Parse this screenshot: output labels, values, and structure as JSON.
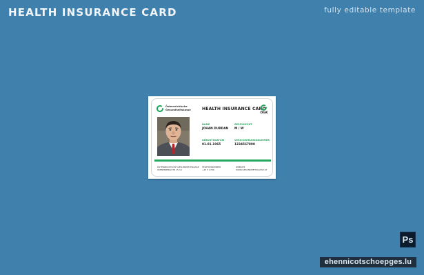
{
  "header": {
    "title": "HEALTH INSURANCE CARD",
    "subtitle": "fully editable template"
  },
  "card": {
    "brand_line1": "Österreichische",
    "brand_line2": "Gesundheitskasse",
    "title": "HEALTH INSURANCE CARD",
    "gkk_label": "ÖGK",
    "name_label": "NAME",
    "name_value": "JOHAN DURDAN",
    "gender_label": "GESCHLECHT",
    "gender_value": "M / W",
    "birthdate_label": "GEBURTSDATUM",
    "birthdate_value": "01.01.1965",
    "insurance_label": "VERSICHERUNGSNUMMER",
    "insurance_value": "1234567890",
    "footer_col1_line1": "ÖSTERREICHISCHE GESUNDHEITSKASSE",
    "footer_col1_line2": "WIENERBERGSTR 15-19",
    "footer_col2_line1": "TELEFONNUMMER",
    "footer_col2_line2": "+43 5 0766",
    "footer_col3_line1": "WEBSITE",
    "footer_col3_line2": "WWW.GESUNDHEITSKASSE.AT"
  },
  "badges": {
    "ps_label": "Ps",
    "site_label": "ehennicotschoepges.lu"
  },
  "colors": {
    "background": "#3f80ad",
    "accent_green": "#21a85c"
  },
  "icons": {
    "brand_logo": "green-ring-logo",
    "gkk_logo": "gkk-ring-logo"
  }
}
